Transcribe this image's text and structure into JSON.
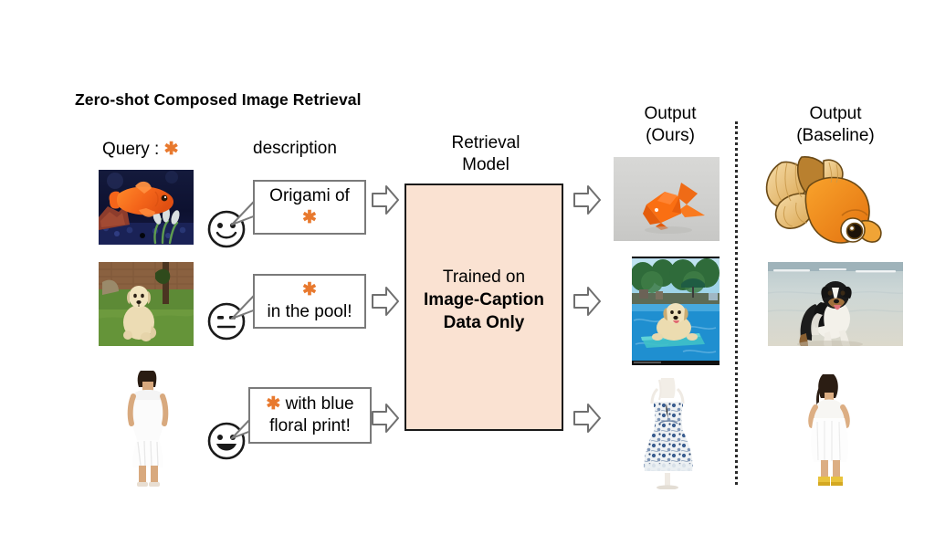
{
  "figure": {
    "title": "Zero-shot Composed Image Retrieval",
    "asterisk_glyph": "✱",
    "accent_color": "#E8792E",
    "box_fill_color": "#FAE2D2",
    "box_border_color": "#1a1a1a"
  },
  "labels": {
    "query": "Query : ",
    "description": "description",
    "retrieval_model_line1": "Retrieval",
    "retrieval_model_line2": "Model",
    "model_body_line1": "Trained on",
    "model_body_line2": "Image-Caption",
    "model_body_line3": "Data Only",
    "output_ours_line1": "Output",
    "output_ours_line2": "(Ours)",
    "output_baseline_line1": "Output",
    "output_baseline_line2": "(Baseline)"
  },
  "rows": [
    {
      "query_image": "goldfish-in-aquarium",
      "face": "smiling-face",
      "caption_line1": "Origami of",
      "caption_line2": "✱",
      "caption_order": "text-then-asterisk",
      "output_ours_image": "orange-origami-fish",
      "output_baseline_image": "cartoon-goldfish-illustration"
    },
    {
      "query_image": "golden-retriever-on-grass",
      "face": "neutral-face",
      "caption_line1": "✱",
      "caption_line2": "in the pool!",
      "caption_order": "asterisk-then-text",
      "output_ours_image": "dog-on-float-in-pool",
      "output_baseline_image": "border-collie-on-beach"
    },
    {
      "query_image": "woman-in-white-dress",
      "face": "grinning-face",
      "caption_line1": "✱ with blue",
      "caption_line2": "floral print!",
      "caption_order": "asterisk-inline",
      "output_ours_image": "blue-floral-print-dress-on-mannequin",
      "output_baseline_image": "woman-in-white-dress-yellow-shoes"
    }
  ]
}
